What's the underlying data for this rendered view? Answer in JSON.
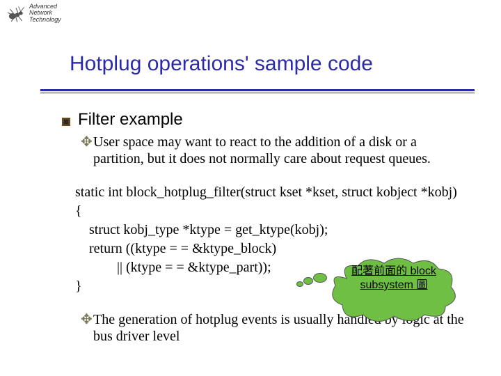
{
  "logo": {
    "line1": "Advanced",
    "line2": "Network",
    "line3": "Technology"
  },
  "title": "Hotplug operations' sample code",
  "bullet1": "Filter example",
  "sub1": "User space may want to react to the addition of a disk or a partition, but it does not normally care about request queues.",
  "code": {
    "l1": "static int block_hotplug_filter(struct kset *kset, struct kobject *kobj)",
    "l2": "{",
    "l3": "    struct kobj_type *ktype = get_ktype(kobj);",
    "l4": "    return ((ktype = = &ktype_block)",
    "l5": "            || (ktype = = &ktype_part));",
    "l6": "}"
  },
  "cloud": "配著前面的 block subsystem 圖",
  "sub2": "The generation of hotplug events is usually handled by logic at the bus driver level",
  "colors": {
    "title": "#2a2aaa",
    "cloud_fill": "#6fbf44"
  }
}
